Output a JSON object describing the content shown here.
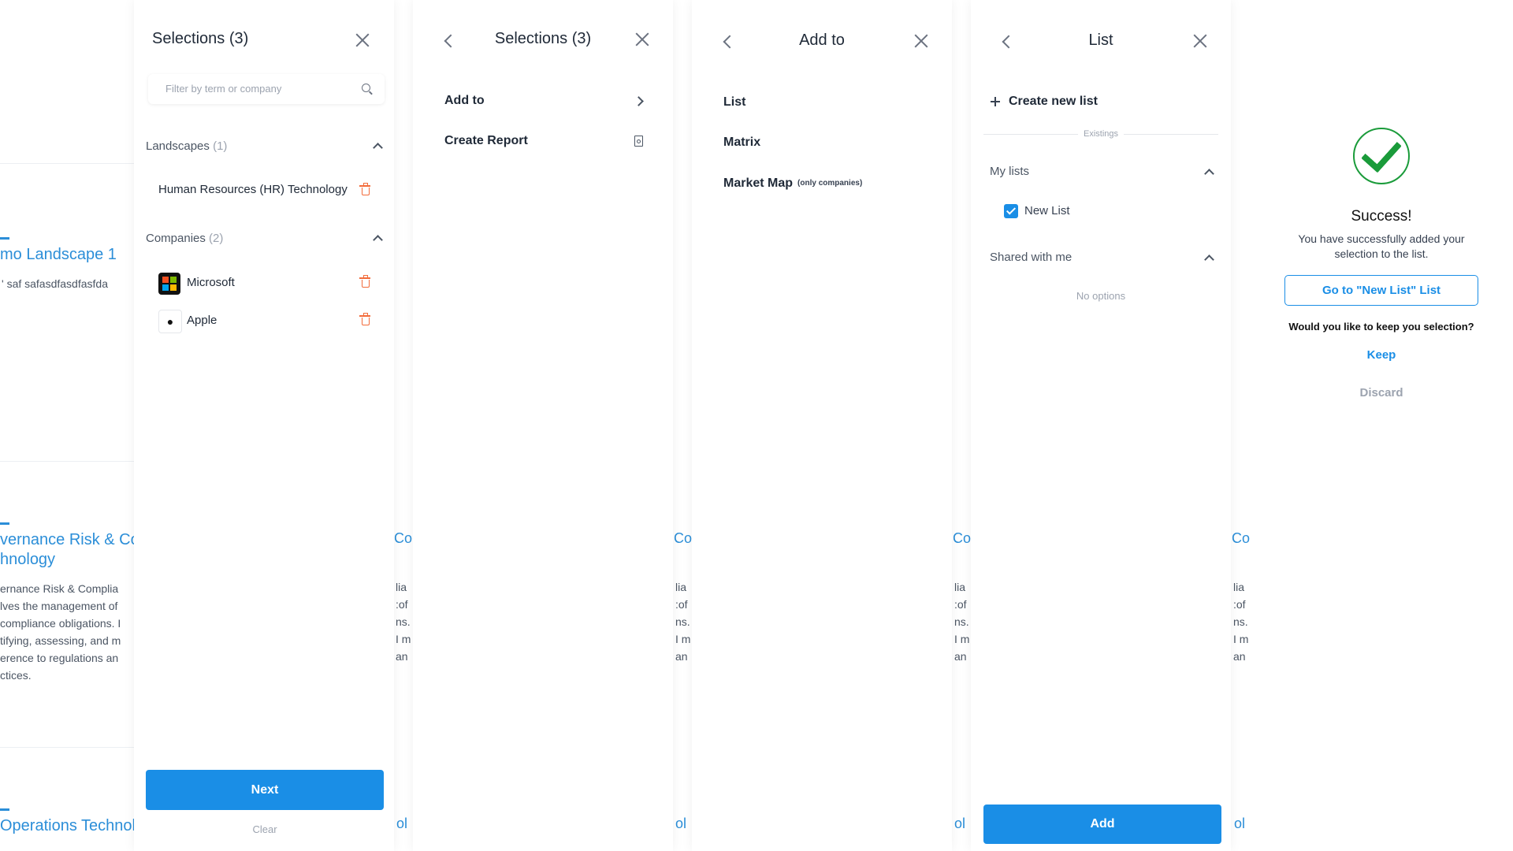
{
  "background": {
    "cards": [
      {
        "title": "mo Landscape 1",
        "desc": "' saf safasdfasdfasfda"
      },
      {
        "title_lines": [
          "vernance Risk & Co",
          "hnology"
        ],
        "desc_lines": [
          "ernance Risk & Complia",
          "lves the management of",
          "compliance obligations. I",
          "tifying, assessing, and m",
          "erence to regulations an",
          "ctices."
        ]
      },
      {
        "title": "Operations Technol"
      }
    ],
    "strip_title": "Co",
    "strip_body": [
      "lia",
      ":of",
      "ns. I",
      "I m",
      "an"
    ],
    "strip_bottom": "ol"
  },
  "panel1": {
    "title": "Selections (3)",
    "search_placeholder": "Filter by term or company",
    "landscapes": {
      "label": "Landscapes",
      "count": "(1)",
      "items": [
        "Human Resources (HR) Technology"
      ]
    },
    "companies": {
      "label": "Companies",
      "count": "(2)",
      "items": [
        "Microsoft",
        "Apple"
      ]
    },
    "next_label": "Next",
    "clear_label": "Clear"
  },
  "panel2": {
    "title": "Selections (3)",
    "menu": [
      "Add to",
      "Create Report"
    ]
  },
  "panel3": {
    "title": "Add to",
    "options": [
      "List",
      "Matrix",
      "Market Map"
    ],
    "market_map_note": "(only companies)"
  },
  "panel4": {
    "title": "List",
    "create_new": "Create new list",
    "existings_label": "Existings",
    "my_lists": {
      "label": "My lists",
      "items": [
        {
          "name": "New List",
          "checked": true
        }
      ]
    },
    "shared": {
      "label": "Shared with me",
      "empty": "No options"
    },
    "add_label": "Add"
  },
  "panel5": {
    "title": "Success!",
    "message": "You have successfully added your selection to the list.",
    "goto_label": "Go to \"New List\" List",
    "question": "Would you like to keep you selection?",
    "keep_label": "Keep",
    "discard_label": "Discard"
  },
  "colors": {
    "accent": "#1a8ee6",
    "danger": "#f26b3a",
    "success": "#1a9b3a"
  }
}
